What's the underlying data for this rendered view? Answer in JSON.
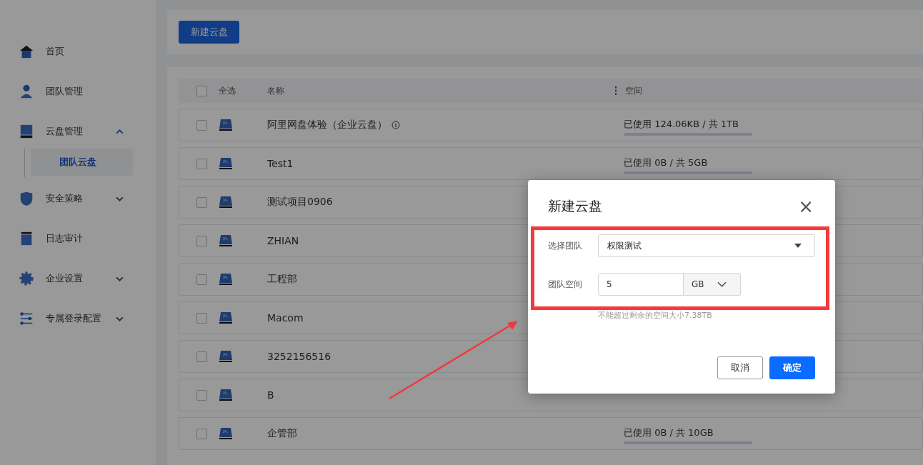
{
  "sidebar": {
    "items": [
      {
        "label": "首页"
      },
      {
        "label": "团队管理"
      },
      {
        "label": "云盘管理",
        "expanded": true,
        "children": [
          {
            "label": "团队云盘",
            "selected": true
          }
        ]
      },
      {
        "label": "安全策略",
        "expanded": false
      },
      {
        "label": "日志审计"
      },
      {
        "label": "企业设置",
        "expanded": false
      },
      {
        "label": "专属登录配置",
        "expanded": false
      }
    ]
  },
  "toolbar": {
    "new_button": "新建云盘"
  },
  "table": {
    "select_all": {
      "label": "全选",
      "checked": false
    },
    "columns": [
      "名称",
      "空间"
    ],
    "rows": [
      {
        "name": "阿里网盘体验（企业云盘）",
        "info": true,
        "checked": false,
        "space": "已使用 124.06KB / 共 1TB"
      },
      {
        "name": "Test1",
        "info": false,
        "checked": false,
        "space": "已使用 0B / 共 5GB"
      },
      {
        "name": "测试项目0906",
        "info": false,
        "checked": false
      },
      {
        "name": "ZHIAN",
        "info": false,
        "checked": false
      },
      {
        "name": "工程部",
        "info": false,
        "checked": false
      },
      {
        "name": "Macom",
        "info": false,
        "checked": false
      },
      {
        "name": "3252156516",
        "info": false,
        "checked": false
      },
      {
        "name": "B",
        "info": false,
        "checked": false
      },
      {
        "name": "企管部",
        "info": false,
        "checked": false,
        "space": "已使用 0B / 共 10GB"
      }
    ]
  },
  "dialog": {
    "title": "新建云盘",
    "close": "×",
    "team_label": "选择团队",
    "team_value": "权限测试",
    "space_label": "团队空间",
    "space_value": "5",
    "unit": "GB",
    "hint": "不能超过剩余的空间大小7.38TB",
    "buttons": [
      {
        "label": "取消",
        "kind": "secondary"
      },
      {
        "label": "确定",
        "kind": "primary"
      }
    ]
  }
}
